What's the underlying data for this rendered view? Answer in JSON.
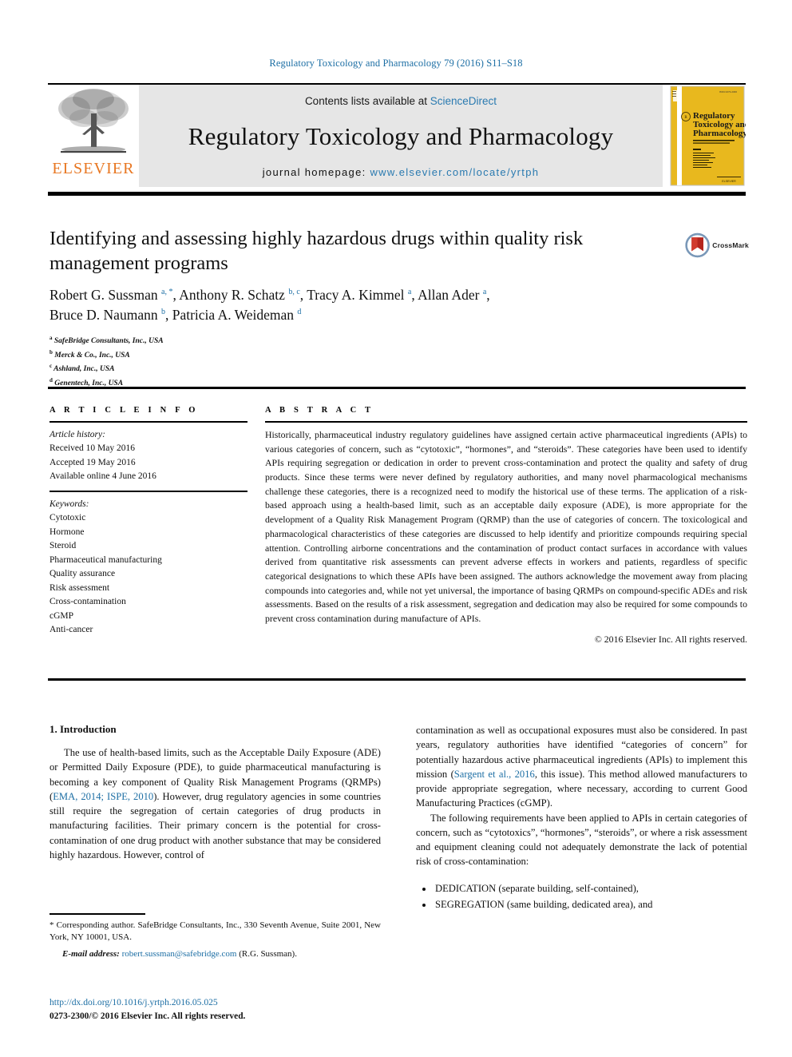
{
  "running_head": "Regulatory Toxicology and Pharmacology 79 (2016) S11–S18",
  "masthead": {
    "publisher_name": "ELSEVIER",
    "contents_prefix": "Contents lists available at ",
    "contents_link": "ScienceDirect",
    "journal_title": "Regulatory Toxicology and Pharmacology",
    "homepage_prefix": "journal homepage: ",
    "homepage_url": "www.elsevier.com/locate/yrtph",
    "cover_title_line1": "Regulatory",
    "cover_title_line2": "Toxicology and",
    "cover_title_line3": "Pharmacology"
  },
  "article": {
    "title": "Identifying and assessing highly hazardous drugs within quality risk management programs",
    "crossmark_label": "CrossMark",
    "authors_line1": "Robert G. Sussman a, *, Anthony R. Schatz b, c, Tracy A. Kimmel a, Allan Ader a,",
    "authors_line2": "Bruce D. Naumann b, Patricia A. Weideman d",
    "authors": [
      {
        "name": "Robert G. Sussman",
        "marks": "a, *"
      },
      {
        "name": "Anthony R. Schatz",
        "marks": "b, c"
      },
      {
        "name": "Tracy A. Kimmel",
        "marks": "a"
      },
      {
        "name": "Allan Ader",
        "marks": "a"
      },
      {
        "name": "Bruce D. Naumann",
        "marks": "b"
      },
      {
        "name": "Patricia A. Weideman",
        "marks": "d"
      }
    ],
    "affiliations": [
      {
        "mark": "a",
        "text": "SafeBridge Consultants, Inc., USA"
      },
      {
        "mark": "b",
        "text": "Merck & Co., Inc., USA"
      },
      {
        "mark": "c",
        "text": "Ashland, Inc., USA"
      },
      {
        "mark": "d",
        "text": "Genentech, Inc., USA"
      }
    ]
  },
  "article_info": {
    "heading": "A R T I C L E   I N F O",
    "history_label": "Article history:",
    "history": [
      "Received 10 May 2016",
      "Accepted 19 May 2016",
      "Available online 4 June 2016"
    ],
    "keywords_label": "Keywords:",
    "keywords": [
      "Cytotoxic",
      "Hormone",
      "Steroid",
      "Pharmaceutical manufacturing",
      "Quality assurance",
      "Risk assessment",
      "Cross-contamination",
      "cGMP",
      "Anti-cancer"
    ]
  },
  "abstract": {
    "heading": "A B S T R A C T",
    "text": "Historically, pharmaceutical industry regulatory guidelines have assigned certain active pharmaceutical ingredients (APIs) to various categories of concern, such as “cytotoxic”, “hormones”, and “steroids”. These categories have been used to identify APIs requiring segregation or dedication in order to prevent cross-contamination and protect the quality and safety of drug products. Since these terms were never defined by regulatory authorities, and many novel pharmacological mechanisms challenge these categories, there is a recognized need to modify the historical use of these terms. The application of a risk-based approach using a health-based limit, such as an acceptable daily exposure (ADE), is more appropriate for the development of a Quality Risk Management Program (QRMP) than the use of categories of concern. The toxicological and pharmacological characteristics of these categories are discussed to help identify and prioritize compounds requiring special attention. Controlling airborne concentrations and the contamination of product contact surfaces in accordance with values derived from quantitative risk assessments can prevent adverse effects in workers and patients, regardless of specific categorical designations to which these APIs have been assigned. The authors acknowledge the movement away from placing compounds into categories and, while not yet universal, the importance of basing QRMPs on compound-specific ADEs and risk assessments. Based on the results of a risk assessment, segregation and dedication may also be required for some compounds to prevent cross contamination during manufacture of APIs.",
    "copyright": "© 2016 Elsevier Inc. All rights reserved."
  },
  "body": {
    "section_heading": "1. Introduction",
    "left_para_1_a": "The use of health-based limits, such as the Acceptable Daily Exposure (ADE) or Permitted Daily Exposure (PDE), to guide pharmaceutical manufacturing is becoming a key component of Quality Risk Management Programs (QRMPs) (",
    "left_para_1_ref": "EMA, 2014; ISPE, 2010",
    "left_para_1_b": "). However, drug regulatory agencies in some countries still require the segregation of certain categories of drug products in manufacturing facilities. Their primary concern is the potential for cross-contamination of one drug product with another substance that may be considered highly hazardous. However, control of",
    "right_para_1_a": "contamination as well as occupational exposures must also be considered. In past years, regulatory authorities have identified “categories of concern” for potentially hazardous active pharmaceutical ingredients (APIs) to implement this mission (",
    "right_para_1_ref": "Sargent et al., 2016",
    "right_para_1_b": ", this issue). This method allowed manufacturers to provide appropriate segregation, where necessary, according to current Good Manufacturing Practices (cGMP).",
    "right_para_2": "The following requirements have been applied to APIs in certain categories of concern, such as “cytotoxics”, “hormones”, “steroids”, or where a risk assessment and equipment cleaning could not adequately demonstrate the lack of potential risk of cross-contamination:",
    "bullets": [
      "DEDICATION (separate building, self-contained),",
      "SEGREGATION (same building, dedicated area), and"
    ]
  },
  "footer": {
    "corresponding_note": "* Corresponding author. SafeBridge Consultants, Inc., 330 Seventh Avenue, Suite 2001, New York, NY 10001, USA.",
    "email_label": "E-mail address:",
    "email": "robert.sussman@safebridge.com",
    "email_suffix": "(R.G. Sussman).",
    "doi": "http://dx.doi.org/10.1016/j.yrtph.2016.05.025",
    "issn_line": "0273-2300/© 2016 Elsevier Inc. All rights reserved."
  },
  "colors": {
    "link_blue": "#1c6ea4",
    "elsevier_orange": "#e87722",
    "masthead_grey": "#e6e6e6",
    "cover_yellow": "#e8b81e"
  }
}
